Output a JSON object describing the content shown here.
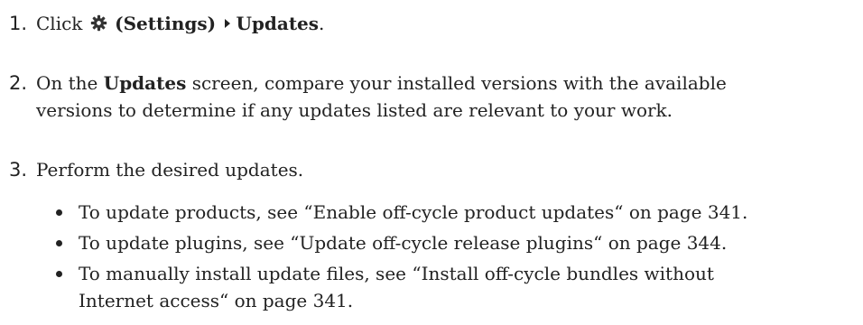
{
  "steps": [
    {
      "number": "1.",
      "click": "Click",
      "settings_label": "(Settings)",
      "updates_label": "Updates",
      "period": ".",
      "gear_icon": "gear-icon",
      "arrow_icon": "triangle-right-icon"
    },
    {
      "number": "2.",
      "line1_prefix": "On the",
      "line1_bold": "Updates",
      "line1_suffix": "screen, compare your installed versions with the available",
      "line2": "versions to determine if any updates listed are relevant to your work."
    },
    {
      "number": "3.",
      "text": "Perform the desired updates."
    }
  ],
  "bullets": [
    {
      "text": "To update products, see “Enable off-cycle product updates“ on page 341."
    },
    {
      "text": "To update plugins, see “Update off-cycle release plugins“ on page 344."
    },
    {
      "line1": "To manually install update files, see “Install off-cycle bundles without",
      "line2": "Internet access“ on page 341."
    }
  ]
}
